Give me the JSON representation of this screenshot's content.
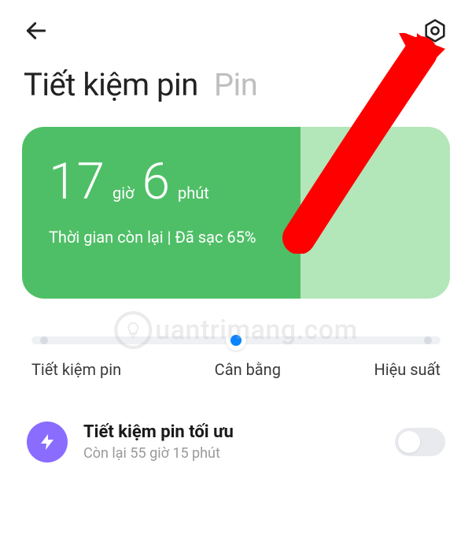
{
  "header": {
    "back_icon": "arrow-left",
    "settings_icon": "gear"
  },
  "tabs": {
    "active": "Tiết kiệm pin",
    "inactive": "Pin"
  },
  "card": {
    "hours": "17",
    "hours_unit": "giờ",
    "minutes": "6",
    "minutes_unit": "phút",
    "status": "Thời gian còn lại | Đã sạc 65%",
    "fill_percent": 65,
    "colors": {
      "fg": "#4fbf67",
      "bg": "#b3e6b8"
    }
  },
  "slider": {
    "labels": [
      "Tiết kiệm pin",
      "Cân bằng",
      "Hiệu suất"
    ],
    "position": 1
  },
  "optimal": {
    "title": "Tiết kiệm pin tối ưu",
    "subtitle": "Còn lại 55 giờ 15 phút",
    "enabled": false
  },
  "watermark": {
    "text": "uantrimang.com"
  }
}
